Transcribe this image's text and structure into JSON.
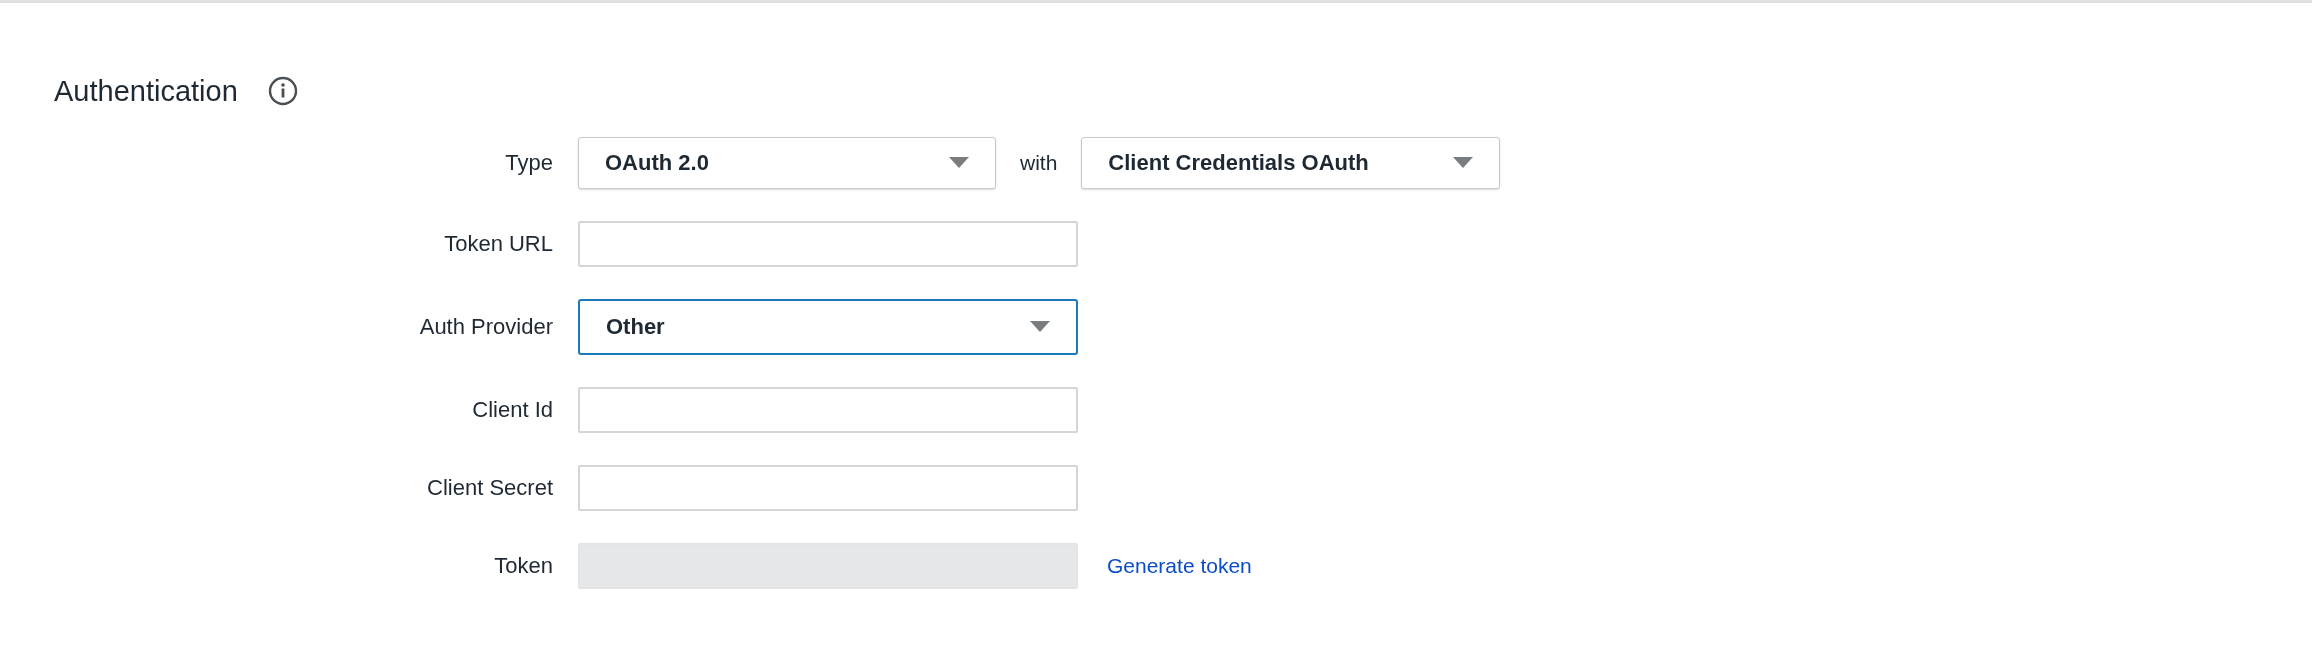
{
  "section": {
    "title": "Authentication"
  },
  "rows": [
    {
      "kind": "select-pair",
      "label": "Type",
      "value": "OAuth 2.0",
      "focused": false,
      "joiner": "with",
      "second_value": "Client Credentials OAuth"
    },
    {
      "kind": "text",
      "label": "Token URL",
      "value": "",
      "disabled": false
    },
    {
      "kind": "select",
      "label": "Auth Provider",
      "value": "Other",
      "focused": true
    },
    {
      "kind": "text",
      "label": "Client Id",
      "value": "",
      "disabled": false
    },
    {
      "kind": "text",
      "label": "Client Secret",
      "value": "",
      "disabled": false
    },
    {
      "kind": "text",
      "label": "Token",
      "value": "",
      "disabled": true,
      "link": "Generate token"
    }
  ]
}
